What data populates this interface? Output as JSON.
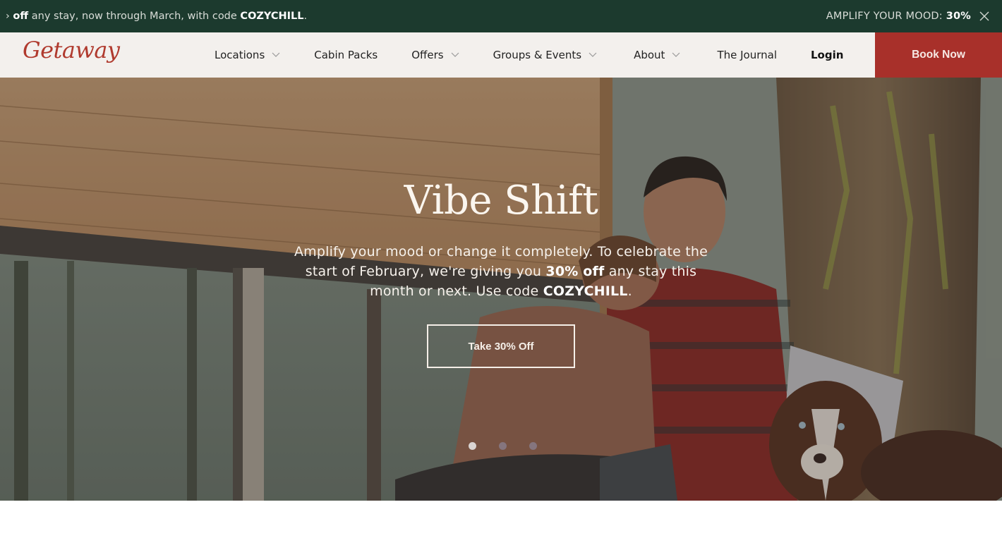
{
  "promo": {
    "marquee_prefix": "› ",
    "marquee_bold1": "off",
    "marquee_text": " any stay, now through March, with code ",
    "marquee_code": "COZYCHILL",
    "marquee_end": ".",
    "right_text": "AMPLIFY YOUR MOOD: ",
    "right_bold": "30%",
    "close_icon": "close-icon"
  },
  "nav": {
    "logo": "Getaway",
    "items": [
      {
        "label": "Locations",
        "has_dropdown": true
      },
      {
        "label": "Cabin Packs",
        "has_dropdown": false
      },
      {
        "label": "Offers",
        "has_dropdown": true
      },
      {
        "label": "Groups & Events",
        "has_dropdown": true
      },
      {
        "label": "About",
        "has_dropdown": true
      },
      {
        "label": "The Journal",
        "has_dropdown": false
      },
      {
        "label": "Login",
        "has_dropdown": false
      }
    ],
    "book_now": "Book Now"
  },
  "hero": {
    "title": "Vibe Shift",
    "body_1": "Amplify your mood or change it completely. To celebrate the start of February, we're giving you ",
    "body_bold_1": "30% off",
    "body_2": " any stay this month or next. Use code ",
    "body_bold_2": "COZYCHILL",
    "body_3": ".",
    "cta": "Take 30% Off",
    "slides_total": 3,
    "active_slide": 1
  },
  "colors": {
    "promo_bg": "#1c3a2e",
    "nav_bg": "#f3f0ed",
    "brand_red": "#a8302a",
    "logo_red": "#b03a2e"
  }
}
